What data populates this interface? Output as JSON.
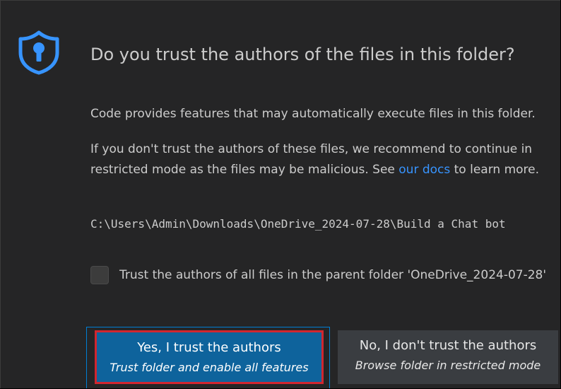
{
  "dialog": {
    "icon": "shield-lock-icon",
    "title": "Do you trust the authors of the files in this folder?",
    "paragraph1": "Code provides features that may automatically execute files in this folder.",
    "paragraph2_before": "If you don't trust the authors of these files, we recommend to continue in restricted mode as the files may be malicious. See ",
    "paragraph2_link": "our docs",
    "paragraph2_after": " to learn more.",
    "folder_path": "C:\\Users\\Admin\\Downloads\\OneDrive_2024-07-28\\Build a Chat bot",
    "checkbox": {
      "checked": false,
      "label": "Trust the authors of all files in the parent folder 'OneDrive_2024-07-28'"
    },
    "buttons": {
      "trust": {
        "label": "Yes, I trust the authors",
        "sublabel": "Trust folder and enable all features"
      },
      "dont_trust": {
        "label": "No, I don't trust the authors",
        "sublabel": "Browse folder in restricted mode"
      }
    }
  },
  "colors": {
    "background": "#252526",
    "text": "#cccccc",
    "link": "#3794ff",
    "icon": "#3794ff",
    "primary_button": "#0e639c",
    "secondary_button": "#3a3d41",
    "highlight_border": "#d1262f"
  }
}
